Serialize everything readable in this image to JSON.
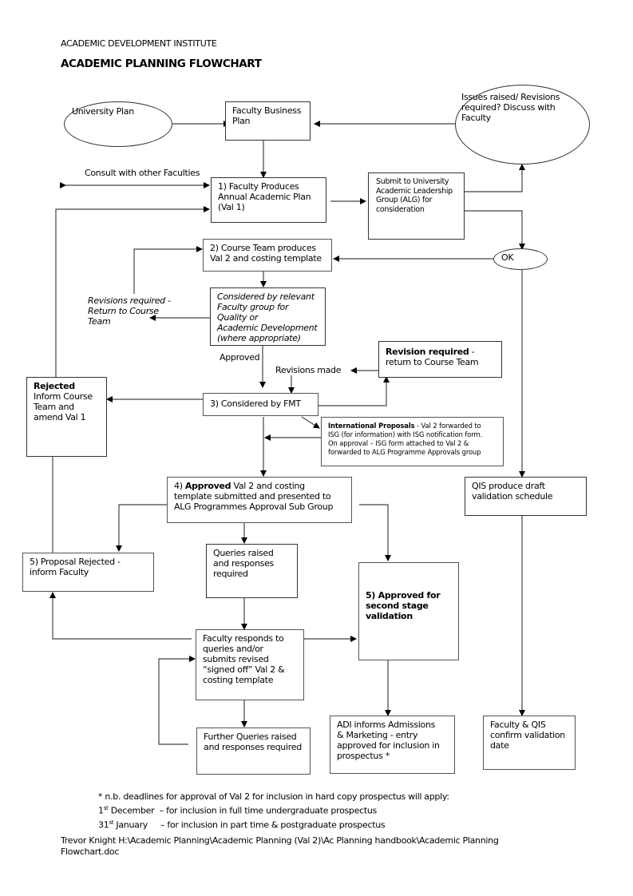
{
  "header": {
    "institute": "ACADEMIC DEVELOPMENT INSTITUTE",
    "title": "ACADEMIC PLANNING FLOWCHART"
  },
  "nodes": {
    "university_plan": "University Plan",
    "faculty_business_plan": [
      "Faculty Business",
      "Plan"
    ],
    "issues_raised": [
      "Issues raised/ Revisions",
      "required?  Discuss with",
      "Faculty"
    ],
    "step1": [
      "1) Faculty Produces",
      "Annual Academic Plan",
      "(Val 1)"
    ],
    "submit_alg": [
      "Submit to University",
      "Academic Leadership",
      "Group (ALG) for",
      "consideration"
    ],
    "ok": "OK",
    "step2": [
      "2) Course Team produces",
      "Val 2 and costing template"
    ],
    "considered_faculty_group": [
      "Considered by relevant",
      "Faculty group for Quality or",
      "Academic Development",
      "(where appropriate)"
    ],
    "revision_required": {
      "bold": "Revision required",
      "rest": " -",
      "line2": "return to Course Team"
    },
    "step3": "3) Considered by FMT",
    "rejected": {
      "bold": "Rejected",
      "lines": [
        "Inform Course",
        "Team and",
        "amend Val 1"
      ]
    },
    "international": {
      "bold": "International Proposals",
      "line1_rest": " - Val 2 forwarded to",
      "lines": [
        "ISG (for information) with ISG notification form.",
        "On approval – ISG form attached to Val 2 &",
        "forwarded to ALG Programme Approvals group"
      ]
    },
    "step4": {
      "prefix": "4) ",
      "bold": "Approved",
      "line1_rest": " Val 2 and costing",
      "lines": [
        "template submitted and presented to",
        "ALG Programmes Approval Sub Group"
      ]
    },
    "qis_draft": [
      "QIS produce draft",
      "validation schedule"
    ],
    "step5_rejected": [
      "5) Proposal Rejected -",
      "inform Faculty"
    ],
    "queries_raised": [
      "Queries raised",
      "and responses",
      "required"
    ],
    "step5_approved": [
      "5) Approved for",
      "second stage",
      "validation"
    ],
    "faculty_responds": [
      "Faculty responds to",
      "queries and/or",
      "submits revised",
      "“signed off” Val 2 &",
      "costing template"
    ],
    "further_queries": [
      "Further Queries raised",
      "and responses required"
    ],
    "adi_informs": [
      "ADI informs Admissions",
      "& Marketing -  entry",
      "approved for inclusion in",
      "prospectus *"
    ],
    "faculty_qis_confirm": [
      "Faculty & QIS",
      "confirm validation",
      "date"
    ]
  },
  "labels": {
    "consult": "Consult with other Faculties",
    "revisions_required": [
      "Revisions required -",
      "Return to Course",
      "Team"
    ],
    "approved": "Approved",
    "revisions_made": "Revisions made"
  },
  "footnote": {
    "note": "* n.b. deadlines for approval of Val 2 for inclusion in hard copy prospectus will apply:",
    "dec_num": "1",
    "dec_sup": "st",
    "dec_text": " December  – for inclusion in full time undergraduate prospectus",
    "jan_num": "31",
    "jan_sup": "st",
    "jan_text": " January     – for inclusion in part time & postgraduate prospectus",
    "path_line1": "Trevor Knight H:\\Academic Planning\\Academic Planning (Val 2)\\Ac Planning handbook\\Academic Planning",
    "path_line2": "Flowchart.doc"
  }
}
